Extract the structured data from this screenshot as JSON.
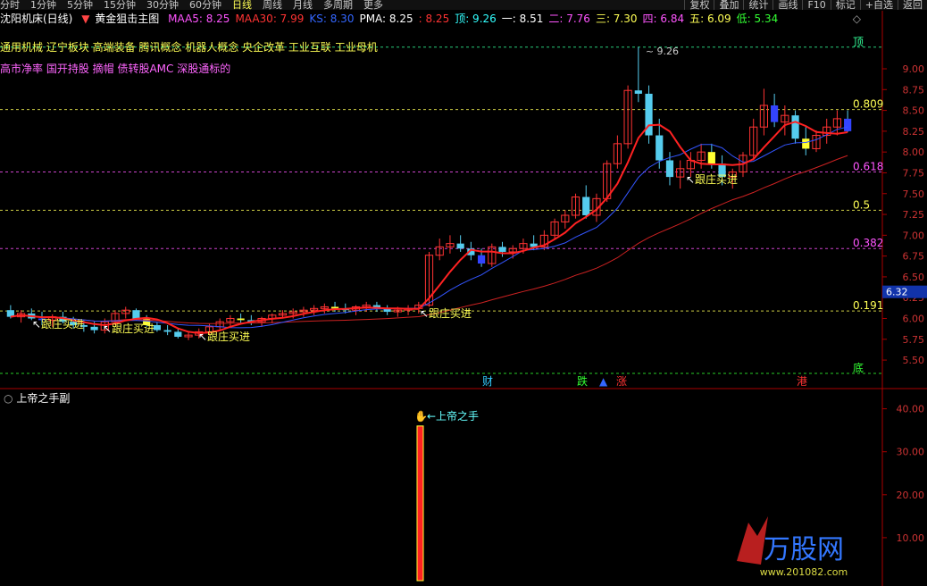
{
  "periods": [
    "分时",
    "1分钟",
    "5分钟",
    "15分钟",
    "30分钟",
    "60分钟",
    "日线",
    "周线",
    "月线",
    "多周期",
    "更多"
  ],
  "active_period": "日线",
  "right_tools": [
    "复权",
    "叠加",
    "统计",
    "画线",
    "F10",
    "标记",
    "+自选",
    "返回"
  ],
  "title": {
    "stock": "沈阳机床(日线)",
    "indicator": "黄金狙击主图",
    "items": [
      {
        "label": "MAA5: 8.25",
        "color": "#ff55ff"
      },
      {
        "label": "MAA30: 7.99",
        "color": "#ff3333"
      },
      {
        "label": "KS: 8.30",
        "color": "#3366ff"
      },
      {
        "label": "PMA: 8.25",
        "color": "#ffffff"
      },
      {
        "label": ": 8.25",
        "color": "#ff3333"
      },
      {
        "label": "顶: 9.26",
        "color": "#33ffff"
      },
      {
        "label": "一: 8.51",
        "color": "#ffffff"
      },
      {
        "label": "二: 7.76",
        "color": "#ff55ff"
      },
      {
        "label": "三: 7.30",
        "color": "#ffff55"
      },
      {
        "label": "四: 6.84",
        "color": "#ff55ff"
      },
      {
        "label": "五: 6.09",
        "color": "#ffff55"
      },
      {
        "label": "低: 5.34",
        "color": "#33ff33"
      }
    ]
  },
  "blocks_line1": "通用机械 辽宁板块 高端装备 腾讯概念 机器人概念 央企改革 工业互联 工业母机",
  "blocks_line2": "高市净率 国开持股 摘帽 债转股AMC 深股通标的",
  "main_axis": {
    "ticks": [
      9.0,
      8.75,
      8.5,
      8.25,
      8.0,
      7.75,
      7.5,
      7.25,
      7.0,
      6.75,
      6.5,
      6.25,
      6.0,
      5.75,
      5.5
    ],
    "min": 5.34,
    "max": 9.44,
    "current": "6.32"
  },
  "fib_levels": [
    {
      "price": 9.26,
      "label": "顶",
      "color": "#33ff99"
    },
    {
      "price": 8.51,
      "label": "0.809",
      "color": "#ffff55"
    },
    {
      "price": 7.76,
      "label": "0.618",
      "color": "#ff55ff"
    },
    {
      "price": 7.3,
      "label": "0.5",
      "color": "#ffff55"
    },
    {
      "price": 6.84,
      "label": "0.382",
      "color": "#ff55ff"
    },
    {
      "price": 6.09,
      "label": "0.191",
      "color": "#ffff55"
    },
    {
      "price": 5.34,
      "label": "底",
      "color": "#33ff33"
    }
  ],
  "peak_label": "9.26",
  "buy_signal_text": "跟庄买进",
  "buy_signals": [
    36,
    115,
    222,
    470,
    768
  ],
  "markers": [
    {
      "text": "财",
      "color": "#33ccff"
    },
    {
      "text": "跌",
      "color": "#33ff33"
    },
    {
      "text": "▲",
      "color": "#3366ff"
    },
    {
      "text": "涨",
      "color": "#ff3333"
    },
    {
      "text": "港",
      "color": "#ff3333"
    }
  ],
  "sub_title": "上帝之手副",
  "sub_axis": {
    "ticks": [
      "40.00",
      "30.00",
      "20.00",
      "10.00"
    ]
  },
  "sub_signal": {
    "label": "←上帝之手",
    "value": 36
  },
  "watermark": {
    "brand": "万股网",
    "url": "www.201082.com"
  },
  "chart_data": {
    "type": "candlestick",
    "title": "沈阳机床(日线)",
    "ylim": [
      5.34,
      9.44
    ],
    "ohlc": [
      [
        6.1,
        6.16,
        6.0,
        6.02
      ],
      [
        6.02,
        6.1,
        5.95,
        6.06
      ],
      [
        6.06,
        6.12,
        5.98,
        6.0
      ],
      [
        6.0,
        6.08,
        5.92,
        5.98
      ],
      [
        5.98,
        6.05,
        5.9,
        6.02
      ],
      [
        6.02,
        6.08,
        5.94,
        5.96
      ],
      [
        5.96,
        6.02,
        5.88,
        5.92
      ],
      [
        5.92,
        5.98,
        5.84,
        5.9
      ],
      [
        5.9,
        5.96,
        5.82,
        5.86
      ],
      [
        5.86,
        6.0,
        5.82,
        5.96
      ],
      [
        5.96,
        6.1,
        5.92,
        6.06
      ],
      [
        6.06,
        6.14,
        6.0,
        6.1
      ],
      [
        6.1,
        6.12,
        5.98,
        6.0
      ],
      [
        6.0,
        6.04,
        5.9,
        5.92
      ],
      [
        5.92,
        5.96,
        5.84,
        5.86
      ],
      [
        5.86,
        5.92,
        5.8,
        5.84
      ],
      [
        5.84,
        5.88,
        5.76,
        5.78
      ],
      [
        5.78,
        5.84,
        5.74,
        5.8
      ],
      [
        5.8,
        5.88,
        5.76,
        5.84
      ],
      [
        5.84,
        5.94,
        5.8,
        5.9
      ],
      [
        5.9,
        6.0,
        5.86,
        5.96
      ],
      [
        5.96,
        6.04,
        5.9,
        6.0
      ],
      [
        6.0,
        6.06,
        5.94,
        5.98
      ],
      [
        5.98,
        6.04,
        5.92,
        5.96
      ],
      [
        5.96,
        6.02,
        5.9,
        6.0
      ],
      [
        6.0,
        6.06,
        5.94,
        6.04
      ],
      [
        6.04,
        6.1,
        6.0,
        6.06
      ],
      [
        6.06,
        6.12,
        6.0,
        6.08
      ],
      [
        6.08,
        6.14,
        6.02,
        6.1
      ],
      [
        6.1,
        6.16,
        6.04,
        6.12
      ],
      [
        6.12,
        6.18,
        6.06,
        6.14
      ],
      [
        6.14,
        6.2,
        6.08,
        6.12
      ],
      [
        6.12,
        6.18,
        6.06,
        6.1
      ],
      [
        6.1,
        6.16,
        6.04,
        6.14
      ],
      [
        6.14,
        6.2,
        6.08,
        6.16
      ],
      [
        6.16,
        6.2,
        6.08,
        6.12
      ],
      [
        6.12,
        6.16,
        6.04,
        6.08
      ],
      [
        6.08,
        6.14,
        6.02,
        6.1
      ],
      [
        6.1,
        6.16,
        6.04,
        6.12
      ],
      [
        6.12,
        6.2,
        6.06,
        6.16
      ],
      [
        6.16,
        6.8,
        6.14,
        6.76
      ],
      [
        6.76,
        6.96,
        6.7,
        6.86
      ],
      [
        6.86,
        7.0,
        6.78,
        6.9
      ],
      [
        6.9,
        7.0,
        6.8,
        6.84
      ],
      [
        6.84,
        6.92,
        6.7,
        6.76
      ],
      [
        6.76,
        6.84,
        6.62,
        6.66
      ],
      [
        6.66,
        6.9,
        6.62,
        6.86
      ],
      [
        6.86,
        6.92,
        6.74,
        6.8
      ],
      [
        6.8,
        6.88,
        6.72,
        6.84
      ],
      [
        6.84,
        6.96,
        6.78,
        6.9
      ],
      [
        6.9,
        7.0,
        6.82,
        6.86
      ],
      [
        6.86,
        7.06,
        6.82,
        7.0
      ],
      [
        7.0,
        7.2,
        6.96,
        7.16
      ],
      [
        7.16,
        7.3,
        7.08,
        7.24
      ],
      [
        7.24,
        7.5,
        7.2,
        7.46
      ],
      [
        7.46,
        7.6,
        7.2,
        7.24
      ],
      [
        7.24,
        7.5,
        7.16,
        7.44
      ],
      [
        7.44,
        7.9,
        7.4,
        7.86
      ],
      [
        7.86,
        8.2,
        7.8,
        8.1
      ],
      [
        8.1,
        8.8,
        8.04,
        8.74
      ],
      [
        8.74,
        9.26,
        8.6,
        8.7
      ],
      [
        8.7,
        8.8,
        8.1,
        8.2
      ],
      [
        8.2,
        8.4,
        7.8,
        7.9
      ],
      [
        7.9,
        8.0,
        7.6,
        7.7
      ],
      [
        7.7,
        7.9,
        7.56,
        7.8
      ],
      [
        7.8,
        8.0,
        7.7,
        7.9
      ],
      [
        7.9,
        8.1,
        7.8,
        8.0
      ],
      [
        8.0,
        8.1,
        7.8,
        7.86
      ],
      [
        7.86,
        7.96,
        7.6,
        7.7
      ],
      [
        7.7,
        7.8,
        7.56,
        7.76
      ],
      [
        7.76,
        8.0,
        7.7,
        7.96
      ],
      [
        7.96,
        8.4,
        7.9,
        8.3
      ],
      [
        8.3,
        8.76,
        8.2,
        8.56
      ],
      [
        8.56,
        8.7,
        8.3,
        8.36
      ],
      [
        8.36,
        8.56,
        8.2,
        8.44
      ],
      [
        8.44,
        8.5,
        8.1,
        8.16
      ],
      [
        8.16,
        8.3,
        7.96,
        8.04
      ],
      [
        8.04,
        8.26,
        8.0,
        8.2
      ],
      [
        8.2,
        8.4,
        8.1,
        8.3
      ],
      [
        8.3,
        8.5,
        8.2,
        8.4
      ],
      [
        8.4,
        8.5,
        8.24,
        8.25
      ]
    ]
  }
}
